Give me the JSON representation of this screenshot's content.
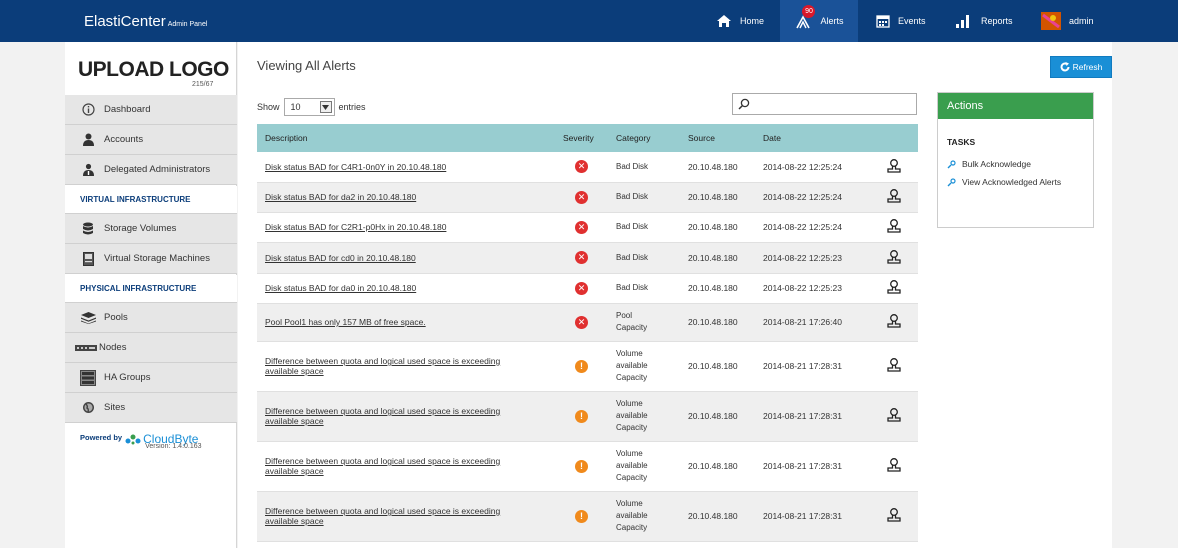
{
  "header": {
    "brand": "ElastiCenter",
    "brand_sub": "Admin Panel",
    "nav": [
      {
        "label": "Home",
        "icon": "home-icon"
      },
      {
        "label": "Alerts",
        "icon": "alerts-icon",
        "badge": "90",
        "active": true
      },
      {
        "label": "Events",
        "icon": "calendar-icon"
      },
      {
        "label": "Reports",
        "icon": "bar-chart-icon"
      },
      {
        "label": "admin",
        "icon": "user-avatar-icon"
      }
    ]
  },
  "sidebar": {
    "logo": "UPLOAD LOGO",
    "logo_sub": "215/67",
    "items": [
      {
        "label": "Dashboard",
        "icon": "info-icon"
      },
      {
        "label": "Accounts",
        "icon": "person-icon"
      },
      {
        "label": "Delegated Administrators",
        "icon": "admin-icon"
      }
    ],
    "section_virtual": "VIRTUAL INFRASTRUCTURE",
    "virtual_items": [
      {
        "label": "Storage Volumes",
        "icon": "database-icon"
      },
      {
        "label": "Virtual Storage Machines",
        "icon": "server-icon"
      }
    ],
    "section_physical": "PHYSICAL INFRASTRUCTURE",
    "physical_items": [
      {
        "label": "Pools",
        "icon": "layers-icon"
      },
      {
        "label": "Nodes",
        "icon": "node-icon"
      },
      {
        "label": "HA Groups",
        "icon": "ha-group-icon"
      },
      {
        "label": "Sites",
        "icon": "globe-icon"
      }
    ],
    "powered_by": "Powered by",
    "company": "CloudByte",
    "version": "Version: 1.4.0.163"
  },
  "main": {
    "title": "Viewing All Alerts",
    "refresh_label": "Refresh",
    "show_label": "Show",
    "entries_value": "10",
    "entries_label": "entries",
    "search_value": "",
    "columns": [
      "Description",
      "Severity",
      "Category",
      "Source",
      "Date",
      ""
    ],
    "rows": [
      {
        "desc1": "Disk status BAD for C4R1-0n0Y in 20.10.48.180",
        "desc2": "",
        "severity": "error",
        "cat1": "Bad Disk",
        "cat2": "",
        "cat3": "",
        "source": "20.10.48.180",
        "date": "2014-08-22 12:25:24"
      },
      {
        "desc1": "Disk status BAD for da2 in 20.10.48.180",
        "desc2": "",
        "severity": "error",
        "cat1": "Bad Disk",
        "cat2": "",
        "cat3": "",
        "source": "20.10.48.180",
        "date": "2014-08-22 12:25:24"
      },
      {
        "desc1": "Disk status BAD for C2R1-p0Hx in 20.10.48.180",
        "desc2": "",
        "severity": "error",
        "cat1": "Bad Disk",
        "cat2": "",
        "cat3": "",
        "source": "20.10.48.180",
        "date": "2014-08-22 12:25:24"
      },
      {
        "desc1": "Disk status BAD for cd0 in 20.10.48.180",
        "desc2": "",
        "severity": "error",
        "cat1": "Bad Disk",
        "cat2": "",
        "cat3": "",
        "source": "20.10.48.180",
        "date": "2014-08-22 12:25:23"
      },
      {
        "desc1": "Disk status BAD for da0 in 20.10.48.180",
        "desc2": "",
        "severity": "error",
        "cat1": "Bad Disk",
        "cat2": "",
        "cat3": "",
        "source": "20.10.48.180",
        "date": "2014-08-22 12:25:23"
      },
      {
        "desc1": "Pool Pool1 has only 157 MB of free space.",
        "desc2": "",
        "severity": "error",
        "cat1": "Pool",
        "cat2": "Capacity",
        "cat3": "",
        "source": "20.10.48.180",
        "date": "2014-08-21 17:26:40"
      },
      {
        "desc1": "Difference between quota and logical used space is exceeding",
        "desc2": "available space",
        "severity": "warning",
        "cat1": "Volume",
        "cat2": "available",
        "cat3": "Capacity",
        "source": "20.10.48.180",
        "date": "2014-08-21 17:28:31"
      },
      {
        "desc1": "Difference between quota and logical used space is exceeding",
        "desc2": "available space",
        "severity": "warning",
        "cat1": "Volume",
        "cat2": "available",
        "cat3": "Capacity",
        "source": "20.10.48.180",
        "date": "2014-08-21 17:28:31"
      },
      {
        "desc1": "Difference between quota and logical used space is exceeding",
        "desc2": "available space",
        "severity": "warning",
        "cat1": "Volume",
        "cat2": "available",
        "cat3": "Capacity",
        "source": "20.10.48.180",
        "date": "2014-08-21 17:28:31"
      },
      {
        "desc1": "Difference between quota and logical used space is exceeding",
        "desc2": "available space",
        "severity": "warning",
        "cat1": "Volume",
        "cat2": "available",
        "cat3": "Capacity",
        "source": "20.10.48.180",
        "date": "2014-08-21 17:28:31"
      }
    ]
  },
  "actions": {
    "title": "Actions",
    "tasks_label": "TASKS",
    "tasks": [
      "Bulk Acknowledge",
      "View Acknowledged Alerts"
    ]
  },
  "colors": {
    "topbar": "#0b3d7a",
    "table_header": "#98cdd0",
    "actions_header": "#3a9e4e",
    "refresh": "#1a8fd6",
    "error": "#e03030",
    "warning": "#f08a1c"
  }
}
